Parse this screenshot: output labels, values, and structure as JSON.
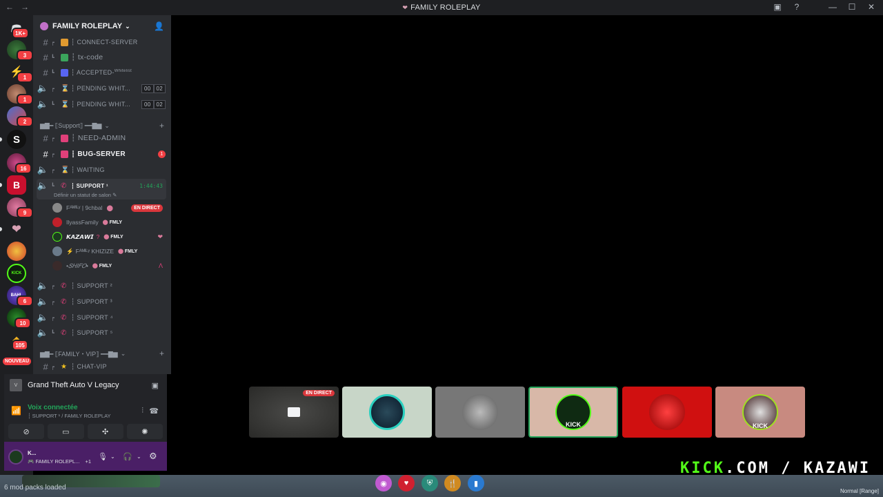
{
  "window": {
    "title": "FAMILY ROLEPLAY"
  },
  "server": {
    "name": "FAMILY ROLEPLAY"
  },
  "rail": {
    "home_badge": "1K+",
    "badges": [
      "3",
      "1",
      "1",
      "2",
      "16",
      "9",
      "6",
      "10",
      "105"
    ],
    "new_label": "NOUVEAU"
  },
  "channels": {
    "connect_server": "┆ CONNECT-SERVER",
    "tx_code": "┆ tx-code",
    "accepted": "┆ ACCEPTED-",
    "accepted_sup": "Whitelist",
    "pending1": "┆ PENDING WHIT...",
    "pending2": "┆ PENDING WHIT...",
    "pending_counts": [
      "00",
      "02"
    ],
    "support_category": "▆▇━ ⟦Support⟧ ━━▇▆",
    "need_admin": "┆ NEED-ADMIN",
    "bug_server": "┆ BUG-SERVER",
    "bug_unread": "1",
    "waiting": "┆ WAITING",
    "support1": "┆ SUPPORT ¹",
    "support1_timer": "1:44:43",
    "support1_status": "Définir un statut de salon",
    "support2": "┆ SUPPORT ²",
    "support3": "┆ SUPPORT ³",
    "support4": "┆ SUPPORT ⁴",
    "support5": "┆ SUPPORT ⁵",
    "family_category": "▆▇━ ⟦FAMILY・VIP⟧ ━━▇▆",
    "chat_vip": "┆ CHAT-VIP"
  },
  "voice_users": [
    {
      "name": "Fᴬᴹᴵᴸʸ | 9chbal",
      "tag": "",
      "live": "EN DIRECT"
    },
    {
      "name": "IlyassFamily",
      "tag": "FMLY"
    },
    {
      "name": "𝙆𝘼𝙕𝘼𝙒𝙄",
      "tag": "FMLY"
    },
    {
      "name": "Fᴬᴹᴵᴸʸ KHIZIZE",
      "tag": "FMLY"
    },
    {
      "name": "•𝑆𝐻𝐼𝐹𝑂•",
      "tag": "FMLY"
    }
  ],
  "activity": {
    "game": "Grand Theft Auto V Legacy"
  },
  "voice": {
    "status": "Voix connectée",
    "channel": "┆ SUPPORT ¹ / FAMILY ROLEPLAY"
  },
  "user": {
    "name": "K...",
    "status": "FAMILY ROLEPL...",
    "extra": "+1"
  },
  "streams": {
    "live_label": "EN DIRECT",
    "kick_label": "KICK",
    "kick_label2": "KICK"
  },
  "overlay": {
    "watermark_kick": "KICK",
    "watermark_rest": ".COM / KAZAWI"
  },
  "game": {
    "mods_text": "6 mod packs loaded",
    "range_text": "Normal [Range]"
  },
  "colors": {
    "accent_green": "#23a55a",
    "live_red": "#da373c",
    "kick_green": "#53fc18",
    "userbar_purple": "#4a1f66"
  }
}
